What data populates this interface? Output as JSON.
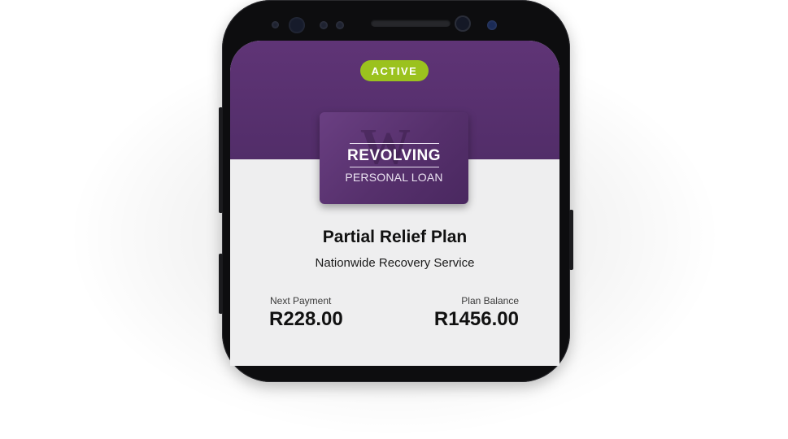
{
  "status": {
    "label": "ACTIVE",
    "color": "#9bc21e"
  },
  "card": {
    "title": "REVOLVING",
    "subtitle": "PERSONAL LOAN",
    "watermark": "W",
    "color": "#5a3272"
  },
  "plan": {
    "title": "Partial Relief Plan",
    "provider": "Nationwide Recovery Service"
  },
  "payments": {
    "next_payment_label": "Next Payment",
    "next_payment_value": "R228.00",
    "balance_label": "Plan Balance",
    "balance_value": "R1456.00"
  },
  "theme": {
    "header_color": "#5a3272",
    "background": "#eeeeef"
  }
}
